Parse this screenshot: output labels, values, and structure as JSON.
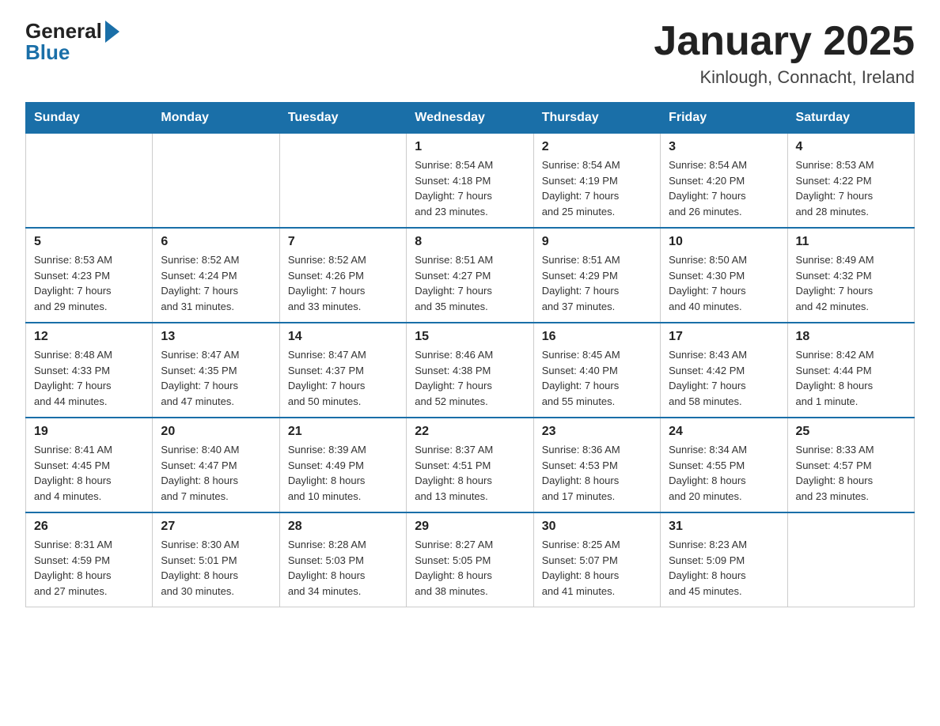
{
  "header": {
    "logo_general": "General",
    "logo_blue": "Blue",
    "main_title": "January 2025",
    "subtitle": "Kinlough, Connacht, Ireland"
  },
  "days_of_week": [
    "Sunday",
    "Monday",
    "Tuesday",
    "Wednesday",
    "Thursday",
    "Friday",
    "Saturday"
  ],
  "weeks": [
    [
      {
        "day": "",
        "info": ""
      },
      {
        "day": "",
        "info": ""
      },
      {
        "day": "",
        "info": ""
      },
      {
        "day": "1",
        "info": "Sunrise: 8:54 AM\nSunset: 4:18 PM\nDaylight: 7 hours\nand 23 minutes."
      },
      {
        "day": "2",
        "info": "Sunrise: 8:54 AM\nSunset: 4:19 PM\nDaylight: 7 hours\nand 25 minutes."
      },
      {
        "day": "3",
        "info": "Sunrise: 8:54 AM\nSunset: 4:20 PM\nDaylight: 7 hours\nand 26 minutes."
      },
      {
        "day": "4",
        "info": "Sunrise: 8:53 AM\nSunset: 4:22 PM\nDaylight: 7 hours\nand 28 minutes."
      }
    ],
    [
      {
        "day": "5",
        "info": "Sunrise: 8:53 AM\nSunset: 4:23 PM\nDaylight: 7 hours\nand 29 minutes."
      },
      {
        "day": "6",
        "info": "Sunrise: 8:52 AM\nSunset: 4:24 PM\nDaylight: 7 hours\nand 31 minutes."
      },
      {
        "day": "7",
        "info": "Sunrise: 8:52 AM\nSunset: 4:26 PM\nDaylight: 7 hours\nand 33 minutes."
      },
      {
        "day": "8",
        "info": "Sunrise: 8:51 AM\nSunset: 4:27 PM\nDaylight: 7 hours\nand 35 minutes."
      },
      {
        "day": "9",
        "info": "Sunrise: 8:51 AM\nSunset: 4:29 PM\nDaylight: 7 hours\nand 37 minutes."
      },
      {
        "day": "10",
        "info": "Sunrise: 8:50 AM\nSunset: 4:30 PM\nDaylight: 7 hours\nand 40 minutes."
      },
      {
        "day": "11",
        "info": "Sunrise: 8:49 AM\nSunset: 4:32 PM\nDaylight: 7 hours\nand 42 minutes."
      }
    ],
    [
      {
        "day": "12",
        "info": "Sunrise: 8:48 AM\nSunset: 4:33 PM\nDaylight: 7 hours\nand 44 minutes."
      },
      {
        "day": "13",
        "info": "Sunrise: 8:47 AM\nSunset: 4:35 PM\nDaylight: 7 hours\nand 47 minutes."
      },
      {
        "day": "14",
        "info": "Sunrise: 8:47 AM\nSunset: 4:37 PM\nDaylight: 7 hours\nand 50 minutes."
      },
      {
        "day": "15",
        "info": "Sunrise: 8:46 AM\nSunset: 4:38 PM\nDaylight: 7 hours\nand 52 minutes."
      },
      {
        "day": "16",
        "info": "Sunrise: 8:45 AM\nSunset: 4:40 PM\nDaylight: 7 hours\nand 55 minutes."
      },
      {
        "day": "17",
        "info": "Sunrise: 8:43 AM\nSunset: 4:42 PM\nDaylight: 7 hours\nand 58 minutes."
      },
      {
        "day": "18",
        "info": "Sunrise: 8:42 AM\nSunset: 4:44 PM\nDaylight: 8 hours\nand 1 minute."
      }
    ],
    [
      {
        "day": "19",
        "info": "Sunrise: 8:41 AM\nSunset: 4:45 PM\nDaylight: 8 hours\nand 4 minutes."
      },
      {
        "day": "20",
        "info": "Sunrise: 8:40 AM\nSunset: 4:47 PM\nDaylight: 8 hours\nand 7 minutes."
      },
      {
        "day": "21",
        "info": "Sunrise: 8:39 AM\nSunset: 4:49 PM\nDaylight: 8 hours\nand 10 minutes."
      },
      {
        "day": "22",
        "info": "Sunrise: 8:37 AM\nSunset: 4:51 PM\nDaylight: 8 hours\nand 13 minutes."
      },
      {
        "day": "23",
        "info": "Sunrise: 8:36 AM\nSunset: 4:53 PM\nDaylight: 8 hours\nand 17 minutes."
      },
      {
        "day": "24",
        "info": "Sunrise: 8:34 AM\nSunset: 4:55 PM\nDaylight: 8 hours\nand 20 minutes."
      },
      {
        "day": "25",
        "info": "Sunrise: 8:33 AM\nSunset: 4:57 PM\nDaylight: 8 hours\nand 23 minutes."
      }
    ],
    [
      {
        "day": "26",
        "info": "Sunrise: 8:31 AM\nSunset: 4:59 PM\nDaylight: 8 hours\nand 27 minutes."
      },
      {
        "day": "27",
        "info": "Sunrise: 8:30 AM\nSunset: 5:01 PM\nDaylight: 8 hours\nand 30 minutes."
      },
      {
        "day": "28",
        "info": "Sunrise: 8:28 AM\nSunset: 5:03 PM\nDaylight: 8 hours\nand 34 minutes."
      },
      {
        "day": "29",
        "info": "Sunrise: 8:27 AM\nSunset: 5:05 PM\nDaylight: 8 hours\nand 38 minutes."
      },
      {
        "day": "30",
        "info": "Sunrise: 8:25 AM\nSunset: 5:07 PM\nDaylight: 8 hours\nand 41 minutes."
      },
      {
        "day": "31",
        "info": "Sunrise: 8:23 AM\nSunset: 5:09 PM\nDaylight: 8 hours\nand 45 minutes."
      },
      {
        "day": "",
        "info": ""
      }
    ]
  ]
}
